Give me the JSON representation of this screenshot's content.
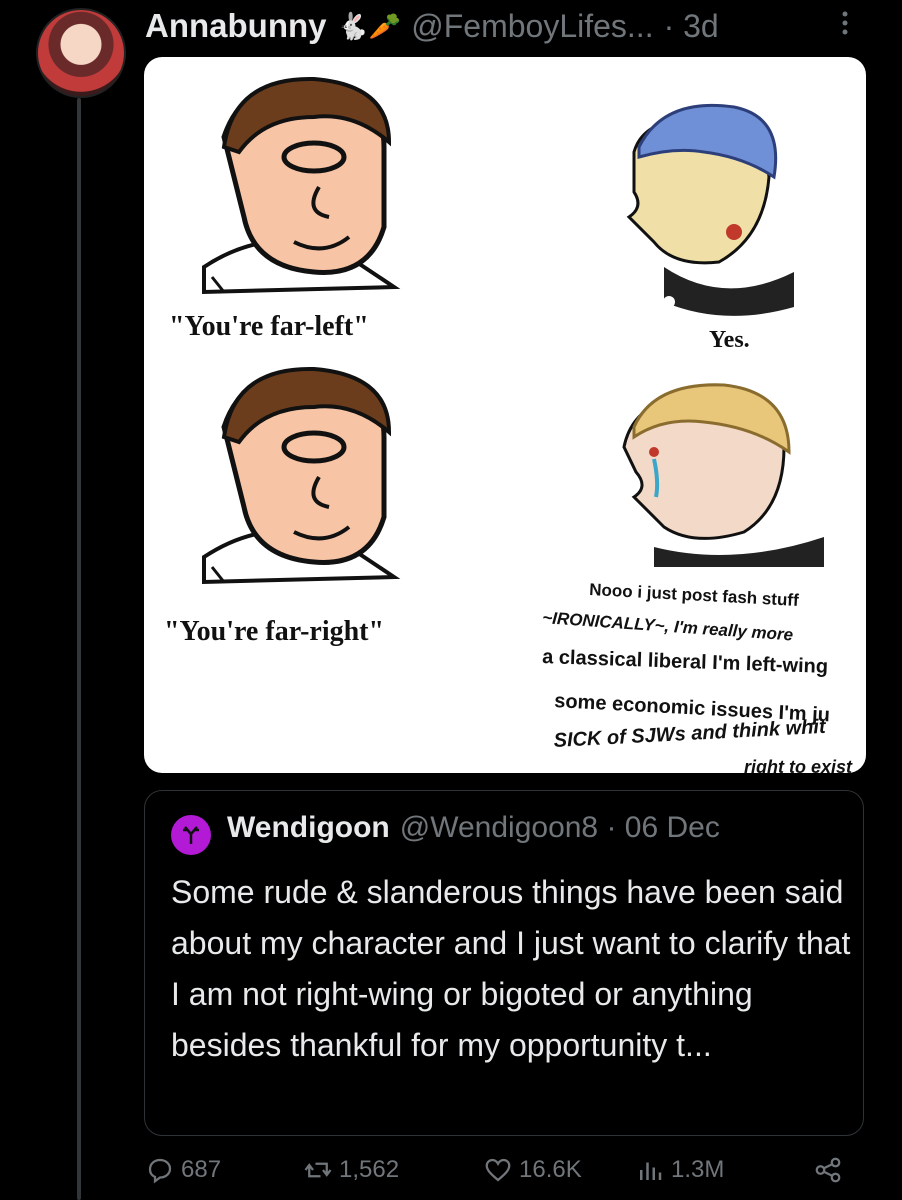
{
  "tweet": {
    "author_name": "Annabunny",
    "author_emoji": "🐇🥕",
    "handle": "@FemboyLifes...",
    "time": "· 3d",
    "more_icon": "more-vertical-icon"
  },
  "meme": {
    "top_left_caption": "\"You're far-left\"",
    "top_right_caption": "Yes.",
    "bottom_left_caption": "\"You're far-right\"",
    "bottom_right_lines": [
      "Nooo i just post fash stuff",
      "~IRONICALLY~, I'm really more",
      "a classical liberal I'm left-wing",
      "some economic issues I'm ju",
      "SICK of SJWs and think whit",
      "right to exist"
    ]
  },
  "quote": {
    "name": "Wendigoon",
    "handle": "@Wendigoon8 · 06 Dec",
    "text": "Some rude & slanderous things have been said about my character and I just want to clarify that I am not right-wing or bigoted or anything besides thankful for my opportunity t..."
  },
  "actions": {
    "replies": "687",
    "retweets": "1,562",
    "likes": "16.6K",
    "views": "1.3M"
  },
  "colors": {
    "background": "#000000",
    "text": "#e7e9ea",
    "secondary": "#71767b",
    "border": "#2f3336",
    "quote_avatar": "#b21ad6"
  }
}
